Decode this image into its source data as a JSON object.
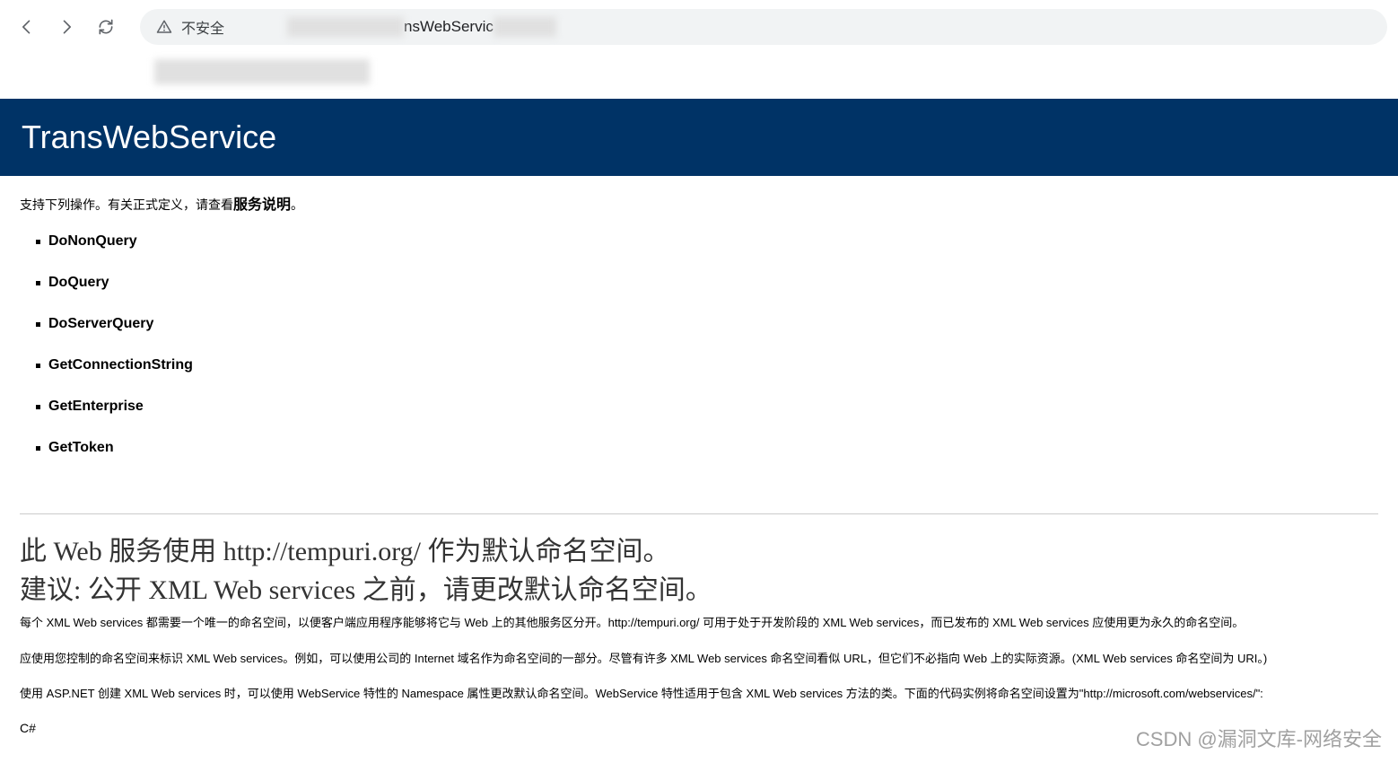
{
  "browser": {
    "security_label": "不安全",
    "url_visible": "nsWebServic",
    "url_blur_left_width": 240,
    "url_blur_mid_width": 130,
    "url_blur_right_width": 70
  },
  "banner": {
    "title": "TransWebService"
  },
  "intro": {
    "prefix": "支持下列操作。有关正式定义，请查看",
    "service_link": "服务说明",
    "suffix": "。"
  },
  "operations": [
    "DoNonQuery",
    "DoQuery",
    "DoServerQuery",
    "GetConnectionString",
    "GetEnterprise",
    "GetToken"
  ],
  "notice": {
    "line1": "此 Web 服务使用 http://tempuri.org/ 作为默认命名空间。",
    "line2": "建议: 公开 XML Web services 之前，请更改默认命名空间。"
  },
  "paragraphs": {
    "p1": "每个 XML Web services 都需要一个唯一的命名空间，以便客户端应用程序能够将它与 Web 上的其他服务区分开。http://tempuri.org/ 可用于处于开发阶段的 XML Web services，而已发布的 XML Web services 应使用更为永久的命名空间。",
    "p2": "应使用您控制的命名空间来标识 XML Web services。例如，可以使用公司的 Internet 域名作为命名空间的一部分。尽管有许多 XML Web services 命名空间看似 URL，但它们不必指向 Web 上的实际资源。(XML Web services 命名空间为 URI。)",
    "p3": "使用 ASP.NET 创建 XML Web services 时，可以使用 WebService 特性的 Namespace 属性更改默认命名空间。WebService 特性适用于包含 XML Web services 方法的类。下面的代码实例将命名空间设置为\"http://microsoft.com/webservices/\":"
  },
  "code_label": "C#",
  "watermark": "CSDN @漏洞文库-网络安全"
}
